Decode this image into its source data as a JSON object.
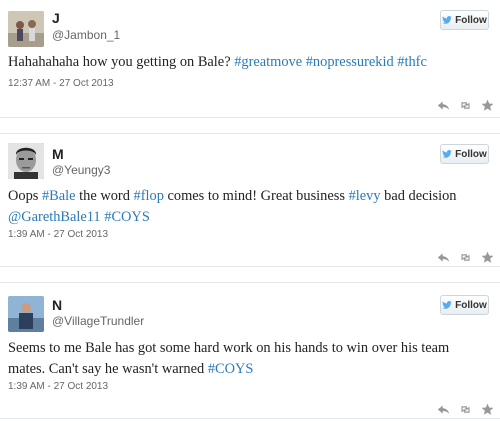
{
  "tweets": [
    {
      "name": "J",
      "handle": "@Jambon_1",
      "follow_label": "Follow",
      "text_parts": [
        {
          "t": "Hahahahaha how you getting on Bale? ",
          "tag": false
        },
        {
          "t": "#greatmove",
          "tag": true
        },
        {
          "t": " ",
          "tag": false
        },
        {
          "t": "#nopressurekid",
          "tag": true
        },
        {
          "t": " ",
          "tag": false
        },
        {
          "t": "#thfc",
          "tag": true
        }
      ],
      "timestamp": "12:37 AM - 27 Oct 2013"
    },
    {
      "name": "M",
      "handle": "@Yeungy3",
      "follow_label": "Follow",
      "text_line1": [
        {
          "t": "Oops ",
          "tag": false
        },
        {
          "t": "#Bale",
          "tag": true
        },
        {
          "t": " the word ",
          "tag": false
        },
        {
          "t": "#flop",
          "tag": true
        },
        {
          "t": " comes to mind! Great business ",
          "tag": false
        },
        {
          "t": "#levy",
          "tag": true
        },
        {
          "t": " bad decision",
          "tag": false
        }
      ],
      "text_line2": [
        {
          "t": "@GarethBale11",
          "tag": true
        },
        {
          "t": " ",
          "tag": false
        },
        {
          "t": "#COYS",
          "tag": true
        }
      ],
      "timestamp": "1:39 AM - 27 Oct 2013"
    },
    {
      "name": "N",
      "handle": "@VillageTrundler",
      "follow_label": "Follow",
      "text_line1": [
        {
          "t": "Seems to me Bale has got some hard work on his hands to win over his team",
          "tag": false
        }
      ],
      "text_line2": [
        {
          "t": "mates. Can't say he wasn't warned ",
          "tag": false
        },
        {
          "t": "#COYS",
          "tag": true
        }
      ],
      "timestamp": "1:39 AM - 27 Oct 2013"
    }
  ],
  "actions": [
    "reply-icon",
    "retweet-icon",
    "favorite-icon"
  ],
  "colors": {
    "link": "#2b7bb9",
    "icon": "#999999",
    "border": "#e1e8ed"
  }
}
